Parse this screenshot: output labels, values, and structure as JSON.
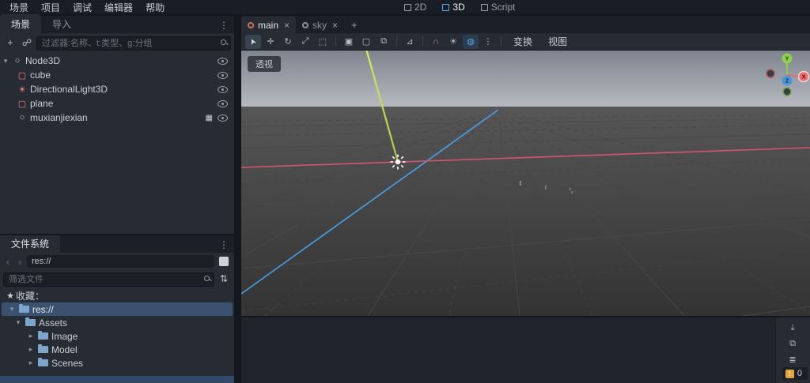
{
  "menubar": {
    "items": [
      {
        "label": "场景"
      },
      {
        "label": "项目"
      },
      {
        "label": "调试"
      },
      {
        "label": "编辑器"
      },
      {
        "label": "帮助"
      }
    ]
  },
  "workspace": {
    "twod": "2D",
    "threed": "3D",
    "script": "Script"
  },
  "icons": {
    "chevron_down": "▾",
    "chevron_right": "▸",
    "dots": "⋮",
    "close": "×",
    "add": "+",
    "link": "☍",
    "back": "‹",
    "forward": "›",
    "sort": "⇅",
    "star": "★",
    "film": "▦",
    "plus_tab": "+",
    "warning": "!"
  },
  "scene_dock": {
    "tab_scene": "场景",
    "tab_import": "导入",
    "filter_placeholder": "过滤器:名称、t:类型、g:分组",
    "tree": [
      {
        "name": "Node3D",
        "glyph": "○",
        "icon": "node3d-icon"
      },
      {
        "name": "cube",
        "glyph": "▢",
        "icon": "mesh-icon"
      },
      {
        "name": "DirectionalLight3D",
        "glyph": "☀",
        "icon": "light-icon"
      },
      {
        "name": "plane",
        "glyph": "▢",
        "icon": "mesh-icon"
      },
      {
        "name": "muxianjiexian",
        "glyph": "○",
        "icon": "node3d-icon"
      }
    ]
  },
  "filesystem": {
    "title": "文件系统",
    "path": "res://",
    "filter_placeholder": "筛选文件",
    "favorites_label": "收藏：",
    "favorite_root": "res://",
    "folders": [
      {
        "name": "Assets"
      },
      {
        "name": "Image"
      },
      {
        "name": "Model"
      },
      {
        "name": "Scenes"
      }
    ]
  },
  "viewport": {
    "tab_main": "main",
    "tab_sky": "sky",
    "perspective": "透视",
    "toolbar": {
      "tools": [
        {
          "name": "select-tool",
          "glyph": "➤"
        },
        {
          "name": "move-tool",
          "glyph": "✛"
        },
        {
          "name": "rotate-tool",
          "glyph": "↻"
        },
        {
          "name": "scale-tool",
          "glyph": "⤢"
        },
        {
          "name": "box-select-tool",
          "glyph": "⬚"
        },
        {
          "name": "lock-button",
          "glyph": "▣"
        },
        {
          "name": "unlock-button",
          "glyph": "▢"
        },
        {
          "name": "group-button",
          "glyph": "⧉"
        },
        {
          "name": "ruler-button",
          "glyph": "⊿"
        },
        {
          "name": "snap-button",
          "glyph": "∩"
        },
        {
          "name": "sun-button",
          "glyph": "☀"
        },
        {
          "name": "environment-button",
          "glyph": "◍"
        },
        {
          "name": "more-button",
          "glyph": "⋮"
        }
      ],
      "menu_transform": "变换",
      "menu_view": "视图"
    },
    "gizmo": {
      "x": "X",
      "y": "Y",
      "z": "Z"
    }
  },
  "bottom_panel": {
    "buttons": [
      {
        "name": "scroll-bottom-button",
        "glyph": "⤓"
      },
      {
        "name": "copy-button",
        "glyph": "⧉"
      },
      {
        "name": "wrap-button",
        "glyph": "≣"
      }
    ],
    "error_count": "0"
  },
  "colors": {
    "accent_blue": "#58aae8",
    "selection_blue": "#3b5170",
    "node_red": "#fc7f7f",
    "folder_blue": "#7ea6cc",
    "axis_red": "#d4556b",
    "axis_blue": "#4aa0e8",
    "light_line": "#c4d94a"
  }
}
